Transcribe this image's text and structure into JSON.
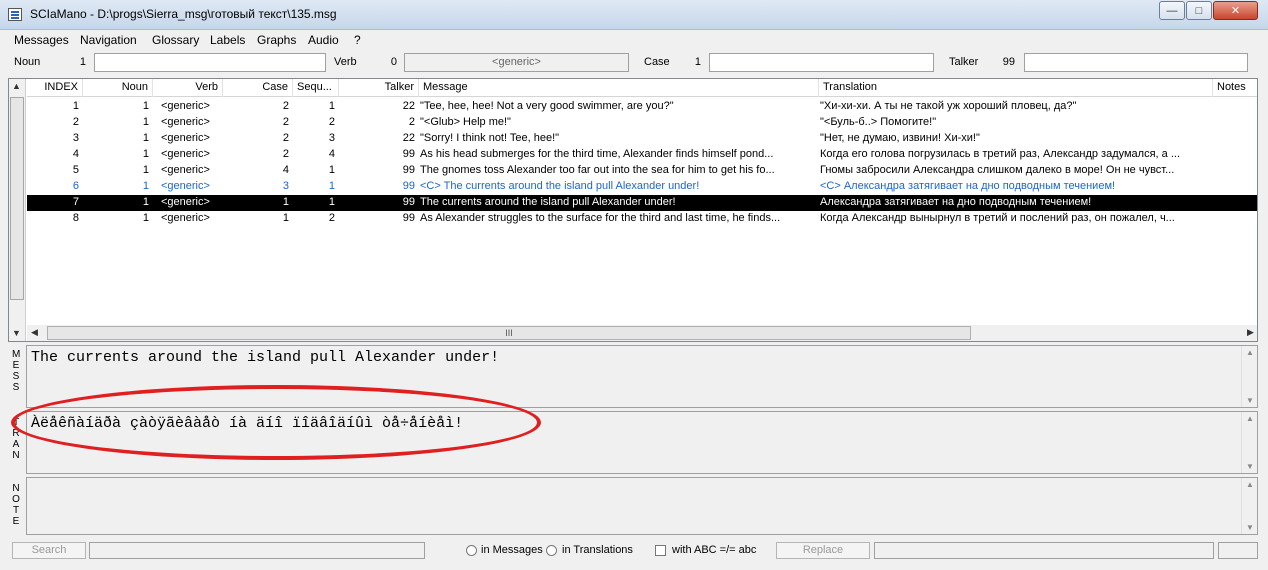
{
  "window": {
    "title": "SCIaMano - D:\\progs\\Sierra_msg\\готовый текст\\135.msg",
    "min": "—",
    "max": "□",
    "close": "✕"
  },
  "menu": [
    "Messages",
    "Navigation",
    "Glossary",
    "Labels",
    "Graphs",
    "Audio",
    "?"
  ],
  "fields": {
    "noun_label": "Noun",
    "noun_value": "1",
    "verb_label": "Verb",
    "verb_value": "0",
    "verb_generic": "<generic>",
    "case_label": "Case",
    "case_value": "1",
    "talker_label": "Talker",
    "talker_value": "99"
  },
  "table": {
    "columns": [
      "INDEX",
      "Noun",
      "Verb",
      "Case",
      "Sequ...",
      "Talker",
      "Message",
      "Translation",
      "Notes"
    ],
    "rows": [
      [
        "1",
        "1",
        "<generic>",
        "2",
        "1",
        "22",
        "\"Tee, hee, hee!  Not a very good swimmer, are you?\"",
        "\"Хи-хи-хи. А ты не такой уж хороший пловец, да?\""
      ],
      [
        "2",
        "1",
        "<generic>",
        "2",
        "2",
        "2",
        "\"<Glub> Help me!\"",
        "\"<Буль-б..> Помогите!\""
      ],
      [
        "3",
        "1",
        "<generic>",
        "2",
        "3",
        "22",
        "\"Sorry!  I think not!  Tee, hee!\"",
        "\"Нет, не думаю, извини!  Хи-хи!\""
      ],
      [
        "4",
        "1",
        "<generic>",
        "2",
        "4",
        "99",
        "As his head submerges for the third time, Alexander finds himself pond...",
        "Когда его голова погрузилась в третий раз, Александр задумался, а ..."
      ],
      [
        "5",
        "1",
        "<generic>",
        "4",
        "1",
        "99",
        "The gnomes toss Alexander too far out into the sea for him to get his fo...",
        "Гномы забросили Александра слишком далеко в море! Он не чувст..."
      ],
      [
        "6",
        "1",
        "<generic>",
        "3",
        "1",
        "99",
        "<C> The currents around the island pull Alexander under!",
        "<C> Александра затягивает на дно подводным течением!"
      ],
      [
        "7",
        "1",
        "<generic>",
        "1",
        "1",
        "99",
        "The currents around the island pull Alexander under!",
        "Александра затягивает на дно подводным течением!"
      ],
      [
        "8",
        "1",
        "<generic>",
        "1",
        "2",
        "99",
        "As Alexander struggles to the surface for the third and last time, he finds...",
        "Когда Александр вынырнул в третий и послений раз, он пожалел, ч..."
      ]
    ],
    "selected_index": "7",
    "highlight_color": "#1e66c8",
    "hscroll_grip": "III"
  },
  "panes": {
    "mess_label": "MESS",
    "mess_text": "The currents around the island pull Alexander under!",
    "tran_label": "TRAN",
    "tran_text": "Àëåêñàíäðà çàòÿãèâàåò íà äíî ïîäâîäíûì òå÷åíèåì!",
    "note_label": "NOTE",
    "note_text": ""
  },
  "annotation": {
    "color": "#e02020"
  },
  "statusbar": {
    "search": "Search",
    "in_messages": "in Messages",
    "in_translations": "in Translations",
    "with_abc": "with ABC =/= abc",
    "replace": "Replace"
  }
}
